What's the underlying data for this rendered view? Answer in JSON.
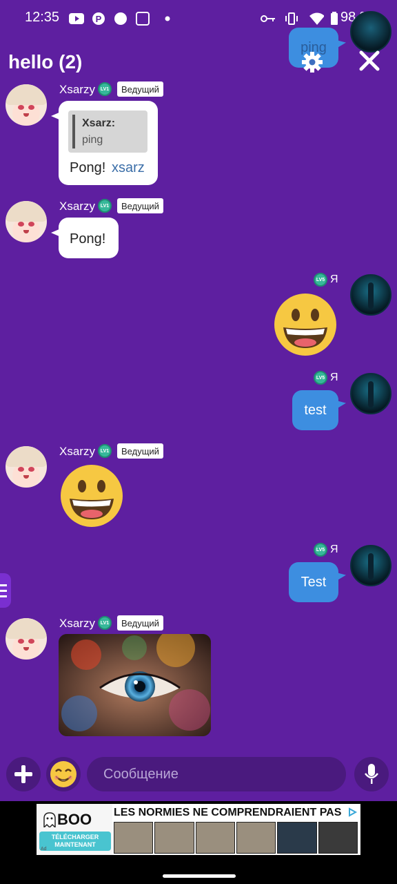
{
  "status_bar": {
    "time": "12:35",
    "battery": "98 %"
  },
  "header": {
    "title": "hello (2)",
    "floating_message": "ping"
  },
  "messages": [
    {
      "author": "Xsarzy",
      "level": "LV1",
      "role": "Ведущий",
      "quote_author": "Xsarz:",
      "quote_text": "ping",
      "text": "Pong!",
      "mention": "xsarz"
    },
    {
      "author": "Xsarzy",
      "level": "LV1",
      "role": "Ведущий",
      "text": "Pong!"
    },
    {
      "author": "Я",
      "level": "LV5",
      "type": "emoji",
      "emoji": "grinning-face"
    },
    {
      "author": "Я",
      "level": "LV5",
      "text": "test"
    },
    {
      "author": "Xsarzy",
      "level": "LV1",
      "role": "Ведущий",
      "type": "emoji",
      "emoji": "grinning-face"
    },
    {
      "author": "Я",
      "level": "LV5",
      "text": "Test"
    },
    {
      "author": "Xsarzy",
      "level": "LV1",
      "role": "Ведущий",
      "type": "image",
      "image": "colorful-eye-photo"
    }
  ],
  "composer": {
    "placeholder": "Сообщение"
  },
  "ad": {
    "brand": "BOO",
    "cta_line1": "TÉLÉCHARGER",
    "cta_line2": "MAINTENANT",
    "headline": "LES NORMIES NE COMPRENDRAIENT PAS",
    "ad_label": "Ad"
  },
  "colors": {
    "background": "#5e1fa0",
    "outgoing_bubble": "#3d8ee0",
    "incoming_bubble": "#ffffff",
    "input_bg": "#4a1a7e",
    "mention": "#3b6ea8"
  }
}
